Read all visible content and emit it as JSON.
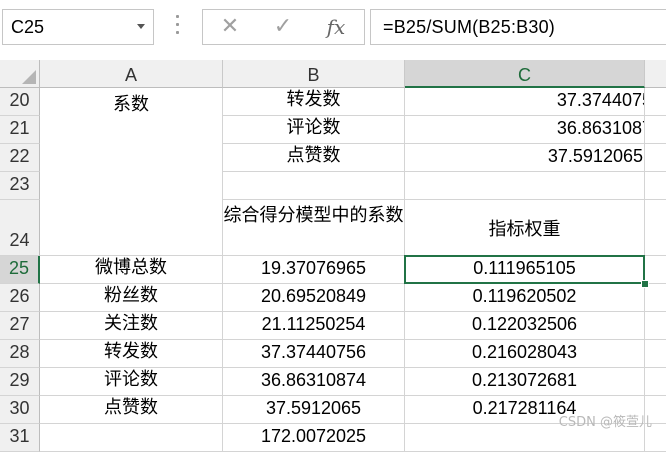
{
  "name_box": {
    "value": "C25"
  },
  "formula_bar": {
    "cancel_symbol": "✕",
    "enter_symbol": "✓",
    "fx_label": "fx",
    "formula": "=B25/SUM(B25:B30)"
  },
  "columns": [
    {
      "label": "A"
    },
    {
      "label": "B"
    },
    {
      "label": "C"
    }
  ],
  "rows": [
    {
      "num": "20",
      "a": "系数",
      "b": "转发数",
      "c": "37.3744075"
    },
    {
      "num": "21",
      "a": "",
      "b": "评论数",
      "c": "36.8631087"
    },
    {
      "num": "22",
      "a": "",
      "b": "点赞数",
      "c": "37.5912065"
    },
    {
      "num": "23",
      "a": "",
      "b": "",
      "c": ""
    },
    {
      "num": "24",
      "a": "",
      "b": "综合得分模型中的系数",
      "c": "指标权重"
    },
    {
      "num": "25",
      "a": "微博总数",
      "b": "19.37076965",
      "c": "0.111965105"
    },
    {
      "num": "26",
      "a": "粉丝数",
      "b": "20.69520849",
      "c": "0.119620502"
    },
    {
      "num": "27",
      "a": "关注数",
      "b": "21.11250254",
      "c": "0.122032506"
    },
    {
      "num": "28",
      "a": "转发数",
      "b": "37.37440756",
      "c": "0.216028043"
    },
    {
      "num": "29",
      "a": "评论数",
      "b": "36.86310874",
      "c": "0.213072681"
    },
    {
      "num": "30",
      "a": "点赞数",
      "b": "37.5912065",
      "c": "0.217281164"
    },
    {
      "num": "31",
      "a": "",
      "b": "172.0072025",
      "c": ""
    }
  ],
  "watermark": "CSDN @筱萱儿",
  "colors": {
    "accent": "#217346",
    "header_bg": "#f0f0f0",
    "grid_line": "#d4d4d4"
  }
}
